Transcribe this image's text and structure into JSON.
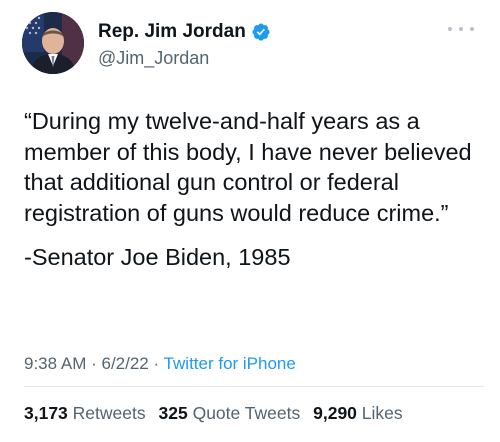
{
  "author": {
    "display_name": "Rep. Jim Jordan",
    "handle": "@Jim_Jordan",
    "verified": true,
    "avatar_icon": "profile-photo",
    "verified_icon": "verified-badge-icon"
  },
  "more_icon": "ellipsis-icon",
  "tweet": {
    "quote": "“During my twelve-and-half years as a member of this body, I have never believed that additional gun control or federal registration of guns would reduce crime.”",
    "attribution": "-Senator Joe Biden, 1985"
  },
  "meta": {
    "time": "9:38 AM",
    "sep1": " · ",
    "date": "6/2/22",
    "sep2": " · ",
    "source": "Twitter for iPhone"
  },
  "stats": {
    "retweets_count": "3,173",
    "retweets_label": "Retweets",
    "quote_tweets_count": "325",
    "quote_tweets_label": "Quote Tweets",
    "likes_count": "9,290",
    "likes_label": "Likes"
  },
  "colors": {
    "text": "#0f1419",
    "secondary": "#536471",
    "accent": "#1d9bf0",
    "divider": "#e4e8eb"
  }
}
